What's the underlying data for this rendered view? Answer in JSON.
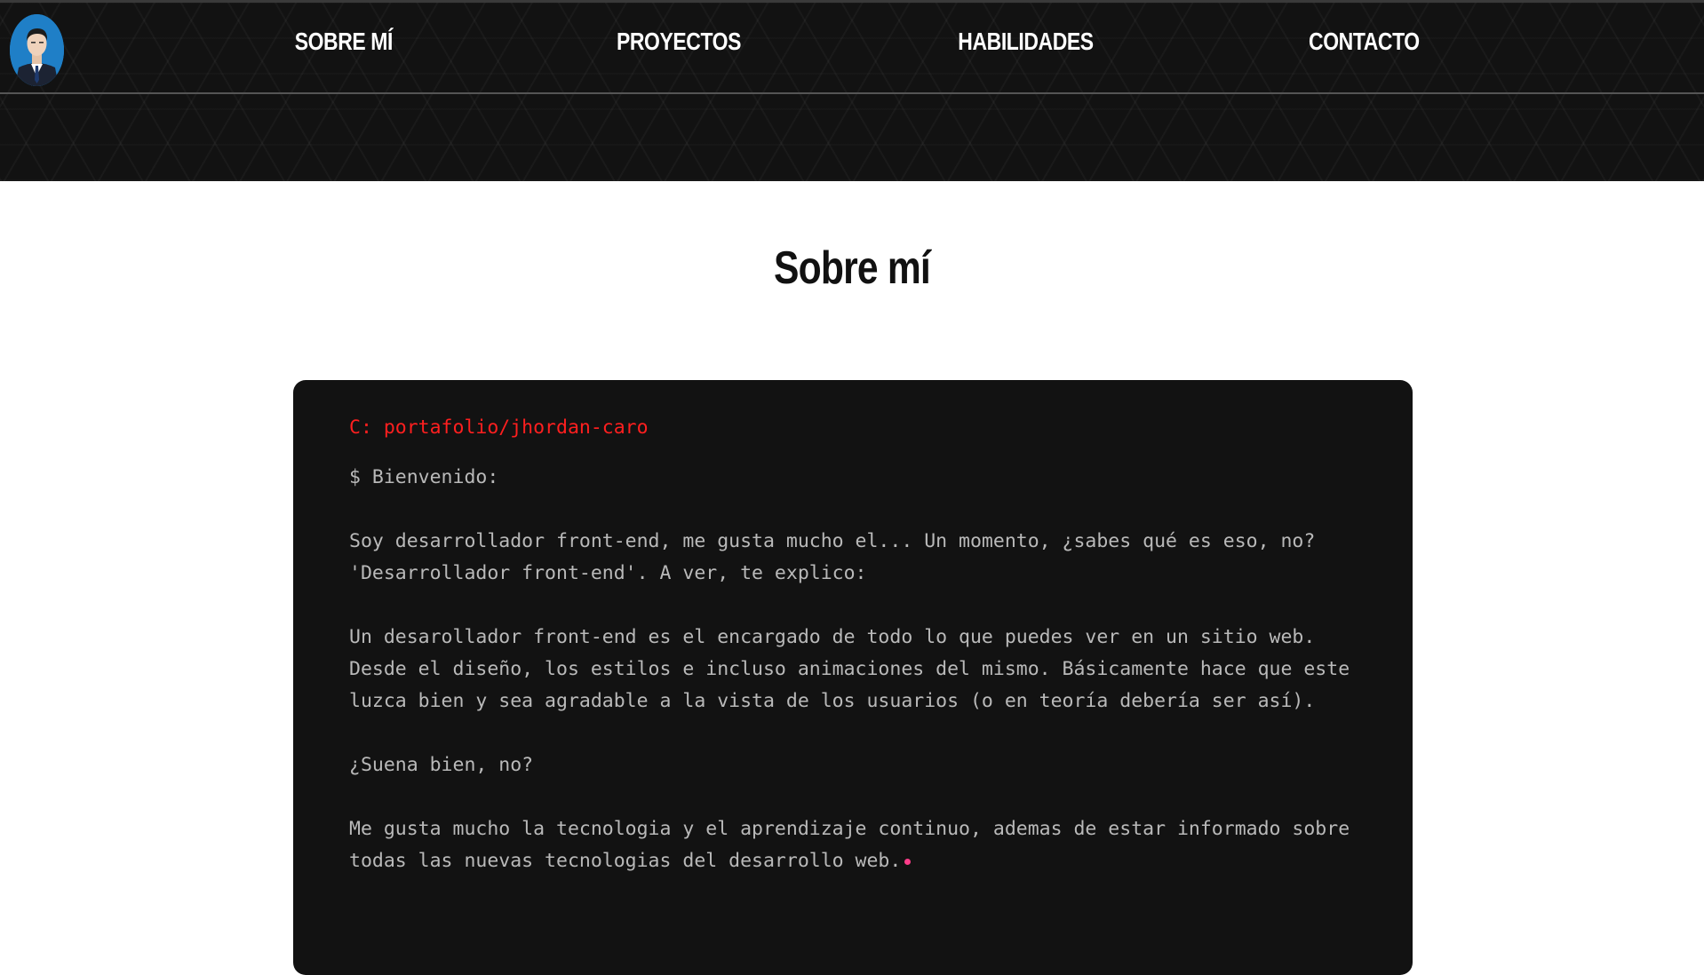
{
  "nav": {
    "items": [
      {
        "label": "SOBRE MÍ"
      },
      {
        "label": "PROYECTOS"
      },
      {
        "label": "HABILIDADES"
      },
      {
        "label": "CONTACTO"
      }
    ]
  },
  "about": {
    "title": "Sobre mí",
    "terminal": {
      "path": "C: portafolio/jhordan-caro",
      "prompt": "$ Bienvenido:",
      "paragraphs": [
        "Soy desarrollador front-end, me gusta mucho el... Un momento, ¿sabes qué es eso, no? 'Desarrollador front-end'. A ver, te explico:",
        "Un desarollador front-end es el encargado de todo lo que puedes ver en un sitio web. Desde el diseño, los estilos e incluso animaciones del mismo. Básicamente hace que este luzca bien y sea agradable a la vista de los usuarios (o en teoría debería ser así).",
        "¿Suena bien, no?",
        "Me gusta mucho la tecnologia y el aprendizaje continuo, ademas de estar informado sobre todas las nuevas tecnologias del desarrollo web."
      ]
    }
  },
  "colors": {
    "header_bg": "#121212",
    "terminal_bg": "#121212",
    "path_color": "#ff1f1f",
    "text_color": "#b9b9b9",
    "cursor_color": "#ff3d8a"
  }
}
